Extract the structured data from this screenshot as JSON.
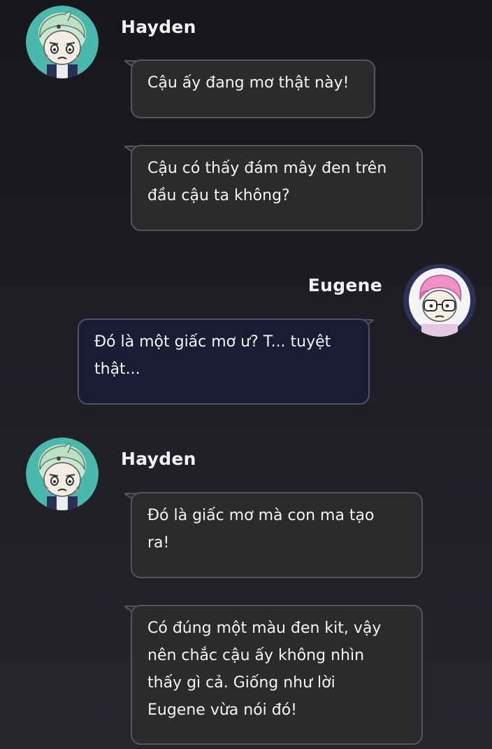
{
  "messages": [
    {
      "sender": "Hayden",
      "side": "left",
      "avatar": "hayden-avatar",
      "bubbles": [
        {
          "lines": [
            "Cậu ấy đang mơ thật này!"
          ]
        },
        {
          "lines": [
            "Cậu có thấy đám mây đen trên",
            "đầu cậu ta không?"
          ]
        }
      ]
    },
    {
      "sender": "Eugene",
      "side": "right",
      "avatar": "eugene-avatar",
      "bubbles": [
        {
          "lines": [
            "Đó là một giấc mơ ư? T... tuyệt",
            "thật..."
          ]
        }
      ]
    },
    {
      "sender": "Hayden",
      "side": "left",
      "avatar": "hayden-avatar",
      "bubbles": [
        {
          "lines": [
            "Đó là giấc mơ mà con ma tạo",
            "ra!"
          ]
        },
        {
          "lines": [
            "Có đúng một màu đen kit, vậy",
            "nên chắc cậu ấy không nhìn",
            "thấy gì cả. Giống như lời",
            "Eugene vừa nói đó!"
          ]
        }
      ]
    }
  ],
  "colors": {
    "background": "#1d1d24",
    "left_bubble": "#2b2b2d",
    "left_border": "#56565a",
    "right_bubble": "#1a1c34",
    "right_border": "#4f5168",
    "text": "#f4f4f4"
  }
}
